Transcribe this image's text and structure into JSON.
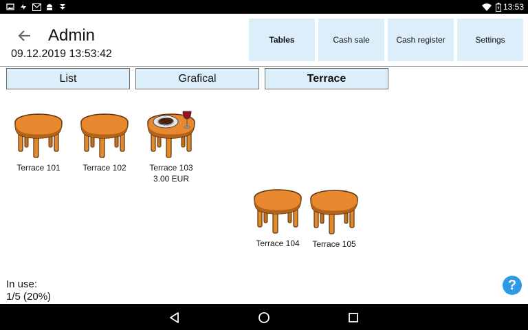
{
  "status_bar": {
    "time": "13:53",
    "left_icons": [
      "image-icon",
      "sync-icon",
      "gmail-icon",
      "android-icon",
      "download-icon"
    ],
    "right_icons": [
      "wifi-icon",
      "battery-icon"
    ]
  },
  "header": {
    "title": "Admin",
    "datetime": "09.12.2019 13:53:42",
    "buttons": [
      {
        "label": "Tables",
        "active": true
      },
      {
        "label": "Cash sale"
      },
      {
        "label": "Cash register"
      },
      {
        "label": "Settings"
      }
    ]
  },
  "tabs": [
    {
      "label": "List"
    },
    {
      "label": "Grafical"
    },
    {
      "label": "Terrace",
      "active": true
    }
  ],
  "tables": [
    {
      "name": "Terrace 101",
      "amount": "",
      "occupied": false
    },
    {
      "name": "Terrace 102",
      "amount": "",
      "occupied": false
    },
    {
      "name": "Terrace 103",
      "amount": "3.00 EUR",
      "occupied": true
    },
    {
      "name": "Terrace 104",
      "amount": "",
      "occupied": false
    },
    {
      "name": "Terrace 105",
      "amount": "",
      "occupied": false
    }
  ],
  "footer": {
    "in_use_label": "In use:",
    "in_use_value": "1/5 (20%)"
  },
  "help": {
    "label": "?"
  },
  "colors": {
    "button_bg": "#dbeefa",
    "table_top": "#e8892f",
    "help_bg": "#2e9ae6"
  }
}
